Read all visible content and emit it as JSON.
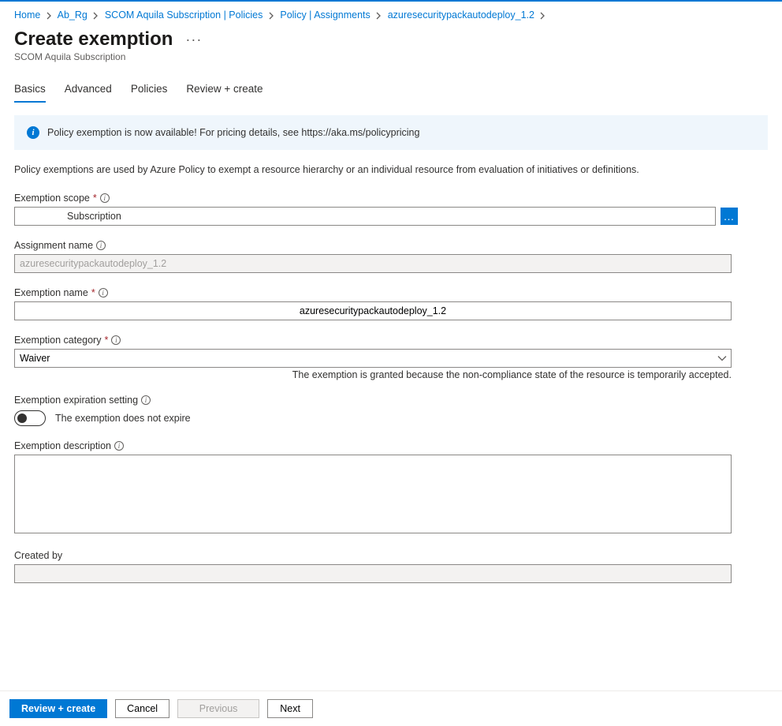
{
  "breadcrumbs": [
    {
      "label": "Home"
    },
    {
      "label": "Ab_Rg"
    },
    {
      "label": "SCOM Aquila Subscription | Policies"
    },
    {
      "label": "Policy | Assignments"
    },
    {
      "label": "azuresecuritypackautodeploy_1.2"
    }
  ],
  "page_title": "Create exemption",
  "page_subtitle": "SCOM Aquila Subscription",
  "tabs": [
    {
      "label": "Basics",
      "active": true
    },
    {
      "label": "Advanced",
      "active": false
    },
    {
      "label": "Policies",
      "active": false
    },
    {
      "label": "Review + create",
      "active": false
    }
  ],
  "info_bar": "Policy exemption is now available! For pricing details, see https://aka.ms/policypricing",
  "intro_text": "Policy exemptions are used by Azure Policy to exempt a resource hierarchy or an individual resource from evaluation of initiatives or definitions.",
  "fields": {
    "scope": {
      "label": "Exemption scope",
      "required": true,
      "value": "Subscription"
    },
    "assignment_name": {
      "label": "Assignment name",
      "required": false,
      "value": "azuresecuritypackautodeploy_1.2"
    },
    "exemption_name": {
      "label": "Exemption name",
      "required": true,
      "value": "azuresecuritypackautodeploy_1.2"
    },
    "exemption_category": {
      "label": "Exemption category",
      "required": true,
      "value": "Waiver",
      "helper": "The exemption is granted because the non-compliance state of the resource is temporarily accepted."
    },
    "expiration": {
      "label": "Exemption expiration setting",
      "toggle_text": "The exemption does not expire"
    },
    "description": {
      "label": "Exemption description",
      "value": ""
    },
    "created_by": {
      "label": "Created by",
      "value": ""
    }
  },
  "footer": {
    "review_create": "Review + create",
    "cancel": "Cancel",
    "previous": "Previous",
    "next": "Next"
  }
}
